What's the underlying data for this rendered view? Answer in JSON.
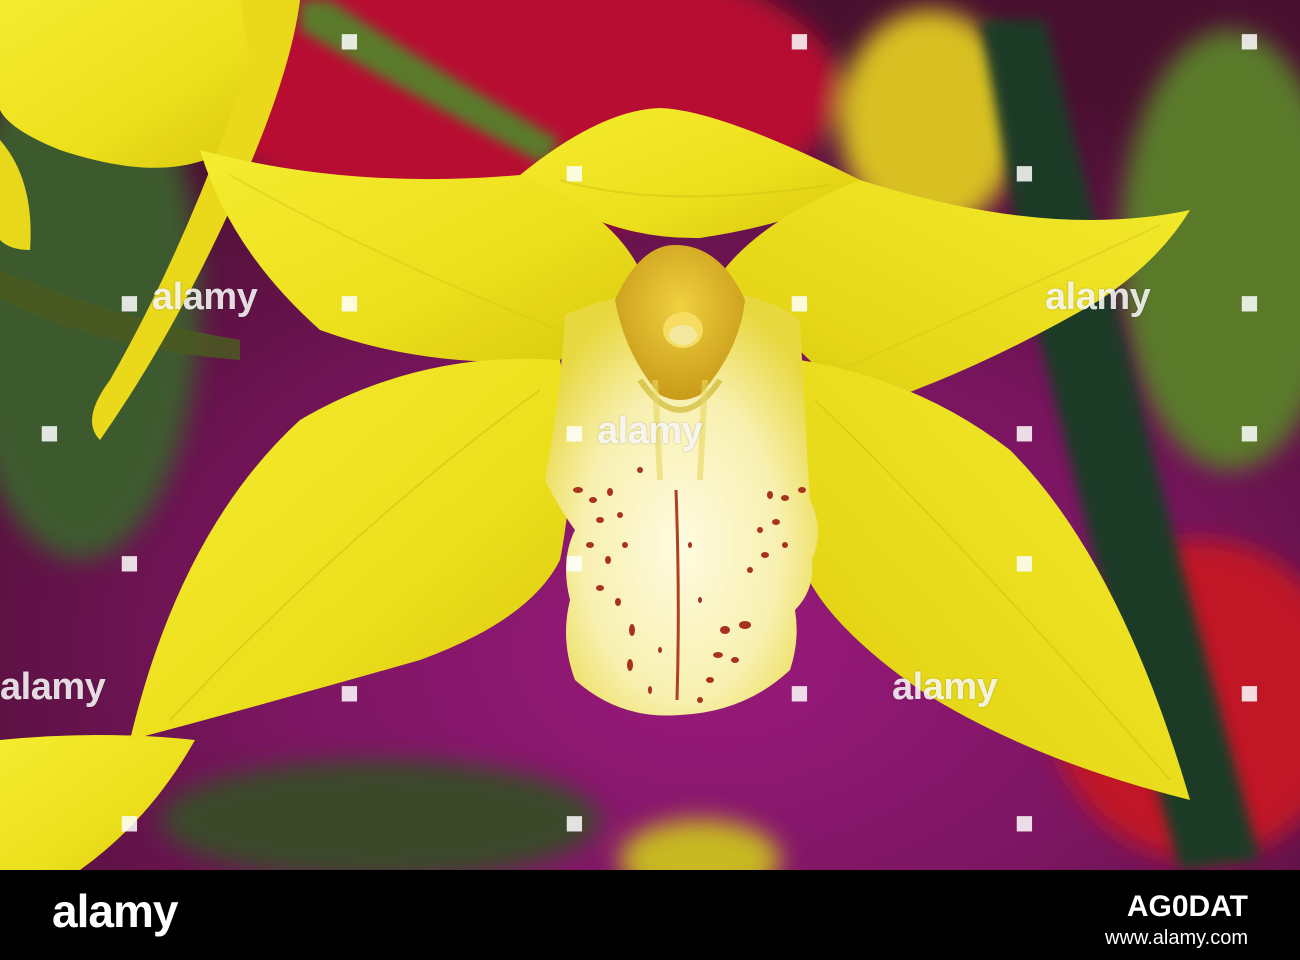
{
  "watermark": {
    "text": "alamy",
    "dot": "■"
  },
  "footer": {
    "logo": "alamy",
    "image_id": "AG0DAT",
    "url": "www.alamy.com"
  },
  "colors": {
    "petal_yellow": "#f2e626",
    "lip_cream": "#fbf3c8",
    "spots": "#a8321e",
    "background_magenta": "#8a1a6a",
    "background_red": "#b0102a"
  }
}
